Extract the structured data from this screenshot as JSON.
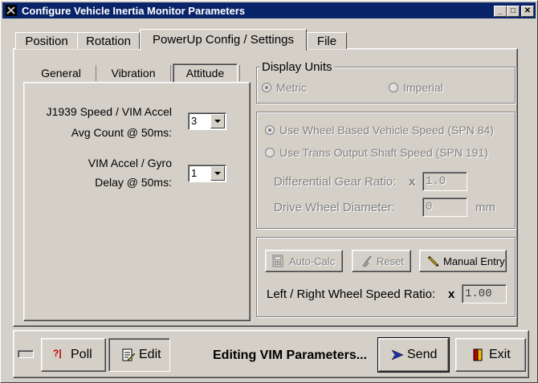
{
  "window": {
    "title": "Configure Vehicle Inertia Monitor Parameters"
  },
  "main_tabs": {
    "position": "Position",
    "rotation": "Rotation",
    "powerup": "PowerUp Config / Settings",
    "file": "File"
  },
  "sub_tabs": {
    "general": "General",
    "vibration": "Vibration",
    "attitude": "Attitude"
  },
  "attitude": {
    "avg_label_1": "J1939 Speed / VIM Accel",
    "avg_label_2": "Avg Count @ 50ms:",
    "avg_value": "3",
    "delay_label_1": "VIM Accel / Gyro",
    "delay_label_2": "Delay @ 50ms:",
    "delay_value": "1"
  },
  "display_units": {
    "legend": "Display Units",
    "metric": "Metric",
    "imperial": "Imperial"
  },
  "speed_source": {
    "wheel_based": "Use Wheel Based Vehicle Speed (SPN 84)",
    "trans_output": "Use Trans Output Shaft Speed (SPN 191)",
    "diff_ratio_label": "Differential Gear Ratio:",
    "diff_ratio_x": "x",
    "diff_ratio_value": "1.0",
    "wheel_diam_label": "Drive Wheel Diameter:",
    "wheel_diam_value": "0",
    "wheel_diam_unit": "mm"
  },
  "ratio": {
    "auto_calc": "Auto-Calc",
    "reset": "Reset",
    "manual_entry": "Manual Entry",
    "label": "Left / Right Wheel Speed Ratio:",
    "x": "x",
    "value": "1.00"
  },
  "footer": {
    "poll": "Poll",
    "poll_prefix": "?|",
    "edit": "Edit",
    "status": "Editing VIM Parameters...",
    "send": "Send",
    "exit": "Exit"
  }
}
